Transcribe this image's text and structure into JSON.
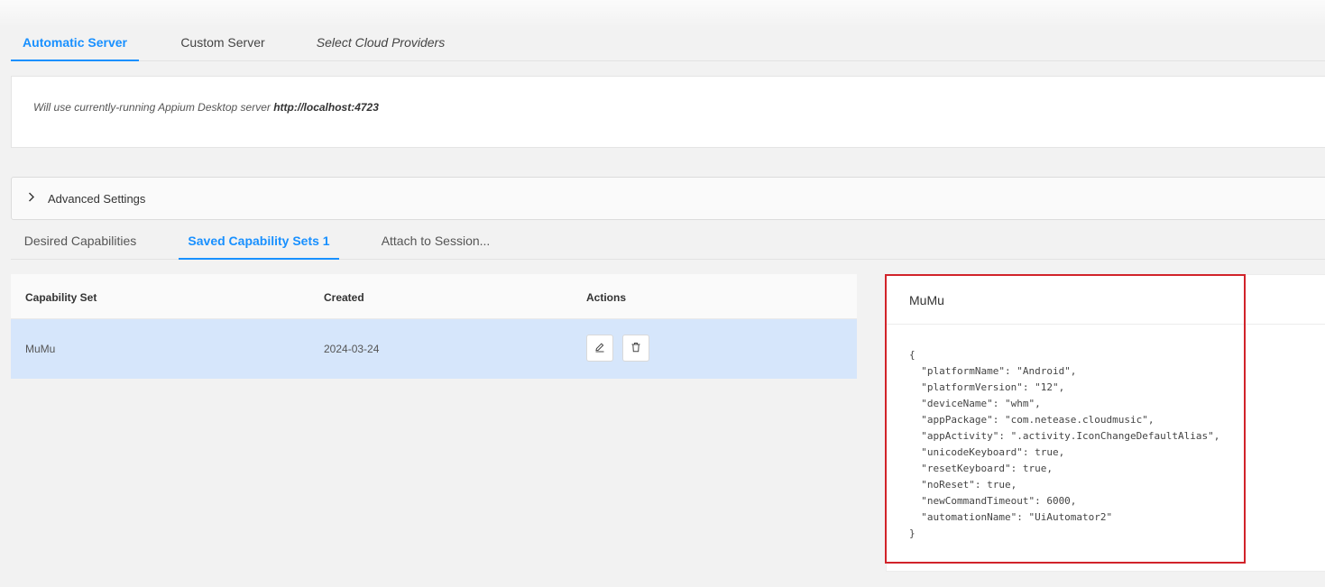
{
  "server_tabs": {
    "automatic": "Automatic Server",
    "custom": "Custom Server",
    "cloud": "Select Cloud Providers"
  },
  "server_info": {
    "prefix": "Will use currently-running Appium Desktop server ",
    "url": "http://localhost:4723"
  },
  "advanced": {
    "label": "Advanced Settings",
    "chevron_icon": "chevron-right-icon"
  },
  "cap_tabs": {
    "desired": "Desired Capabilities",
    "saved": "Saved Capability Sets 1",
    "attach": "Attach to Session..."
  },
  "table": {
    "headers": [
      "Capability Set",
      "Created",
      "Actions"
    ],
    "rows": [
      {
        "name": "MuMu",
        "created": "2024-03-24",
        "actions": [
          "edit-icon",
          "delete-icon"
        ]
      }
    ]
  },
  "detail": {
    "title": "MuMu",
    "json": "{\n  \"platformName\": \"Android\",\n  \"platformVersion\": \"12\",\n  \"deviceName\": \"whm\",\n  \"appPackage\": \"com.netease.cloudmusic\",\n  \"appActivity\": \".activity.IconChangeDefaultAlias\",\n  \"unicodeKeyboard\": true,\n  \"resetKeyboard\": true,\n  \"noReset\": true,\n  \"newCommandTimeout\": 6000,\n  \"automationName\": \"UiAutomator2\"\n}"
  },
  "colors": {
    "accent": "#1890ff",
    "selected_row": "#d6e6fb",
    "highlight_border": "#d1232a"
  }
}
